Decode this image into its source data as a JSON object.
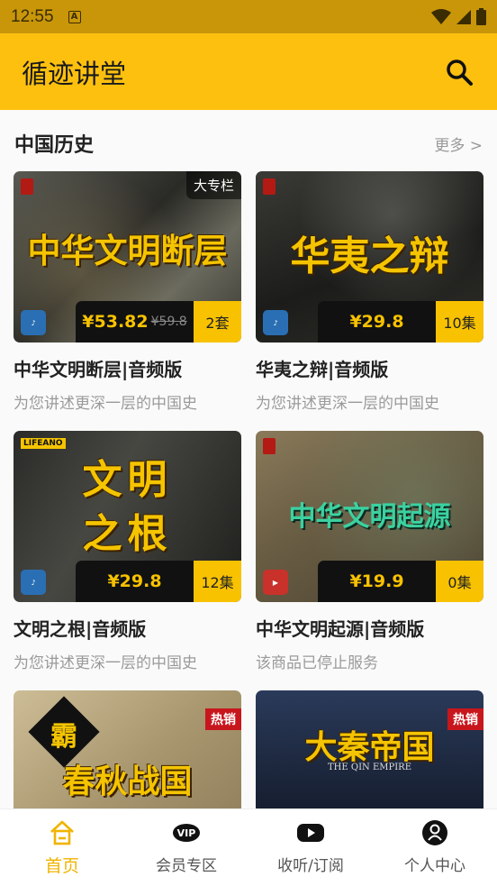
{
  "status": {
    "time": "12:55",
    "a_glyph": "A"
  },
  "appbar": {
    "title": "循迹讲堂"
  },
  "section": {
    "name": "中国历史",
    "more": "更多 >"
  },
  "cards": [
    {
      "headline": "中华文明断层",
      "badge": "大专栏",
      "price": "¥53.82",
      "orig_price": "¥59.8",
      "count": "2套",
      "title": "中华文明断层|音频版",
      "subtitle": "为您讲述更深一层的中国史",
      "media": "audio"
    },
    {
      "headline": "华夷之辩",
      "price": "¥29.8",
      "count": "10集",
      "title": "华夷之辩|音频版",
      "subtitle": "为您讲述更深一层的中国史",
      "media": "audio"
    },
    {
      "headline_line1": "文明",
      "headline_line2": "之根",
      "logo_text": "LIFEANO",
      "price": "¥29.8",
      "count": "12集",
      "title": "文明之根|音频版",
      "subtitle": "为您讲述更深一层的中国史",
      "media": "audio"
    },
    {
      "headline": "中华文明起源",
      "price": "¥19.9",
      "count": "0集",
      "title": "中华文明起源|音频版",
      "subtitle": "该商品已停止服务",
      "media": "video"
    },
    {
      "headline": "春秋战国",
      "seal": "霸",
      "hot": "热销"
    },
    {
      "headline": "大秦帝国",
      "sub_headline": "THE QIN EMPIRE",
      "hot": "热销"
    }
  ],
  "tabbar": {
    "items": [
      {
        "label": "首页",
        "icon": "home-icon",
        "active": true
      },
      {
        "label": "会员专区",
        "icon": "vip-icon"
      },
      {
        "label": "收听/订阅",
        "icon": "play-icon"
      },
      {
        "label": "个人中心",
        "icon": "person-icon"
      }
    ]
  },
  "colors": {
    "accent": "#fec00f",
    "status_bar": "#c9960a",
    "price_text": "#f8c200",
    "hot_badge": "#c8161d"
  }
}
